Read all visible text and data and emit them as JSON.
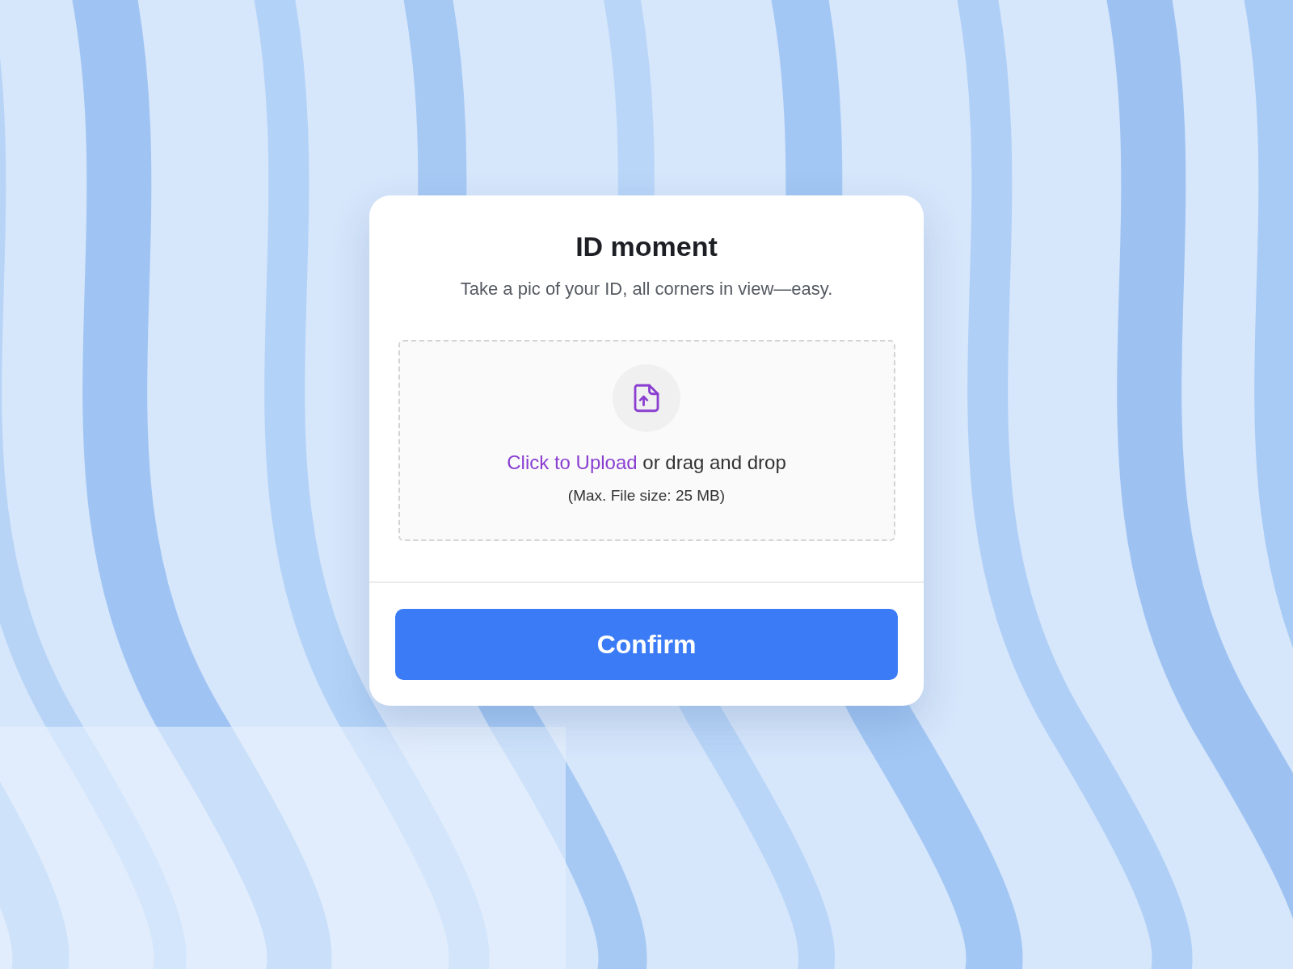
{
  "dialog": {
    "title": "ID moment",
    "subtitle": "Take a pic of your ID, all corners in view—easy."
  },
  "upload": {
    "link": "Click to Upload",
    "text": "or drag and drop",
    "note": "(Max. File size: 25 MB)"
  },
  "button": {
    "label": "Confirm"
  }
}
